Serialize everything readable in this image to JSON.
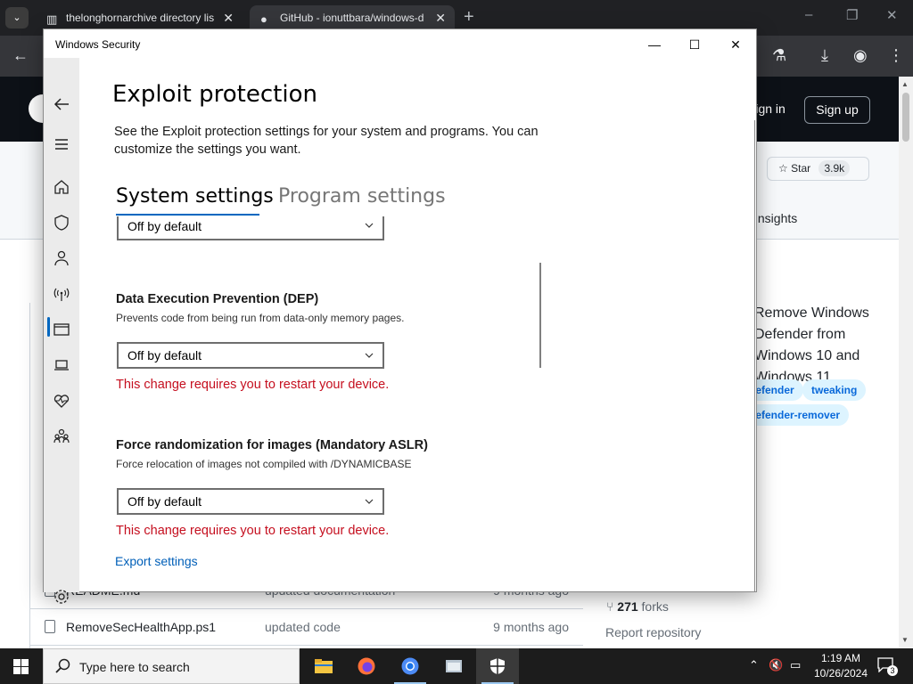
{
  "browser": {
    "tab_menu_icon": "chevron-down-icon",
    "tabs": [
      {
        "title": "thelonghornarchive directory lis",
        "favicon": "archive-icon"
      },
      {
        "title": "GitHub - ionuttbara/windows-d",
        "favicon": "github-icon"
      }
    ],
    "new_tab": "+",
    "window_controls": {
      "minimize": "–",
      "maximize": "❐",
      "close": "✕"
    }
  },
  "github": {
    "sign_in": "Sign in",
    "sign_up": "Sign up",
    "star_label": "Star",
    "star_count": "3.9k",
    "insights_tab": "Insights",
    "description": "Remove Windows Defender from Windows 10 and Windows 11.",
    "topics": [
      "defender",
      "tweaking",
      "defender-remover"
    ],
    "files": [
      {
        "name": "README.md",
        "message": "updated documentation",
        "age": "9 months ago"
      },
      {
        "name": "RemoveSecHealthApp.ps1",
        "message": "updated code",
        "age": "9 months ago"
      }
    ],
    "forks_count": "271",
    "forks_label": "forks",
    "report": "Report repository"
  },
  "windows_security": {
    "window_title": "Windows Security",
    "page_title": "Exploit protection",
    "intro": "See the Exploit protection settings for your system and programs.  You can customize the settings you want.",
    "tabs": {
      "system": "System settings",
      "program": "Program settings"
    },
    "top_dropdown_value": "Off by default",
    "options": [
      {
        "title": "Data Execution Prevention (DEP)",
        "description": "Prevents code from being run from data-only memory pages.",
        "value": "Off by default",
        "warning": "This change requires you to restart your device."
      },
      {
        "title": "Force randomization for images (Mandatory ASLR)",
        "description": "Force relocation of images not compiled with /DYNAMICBASE",
        "value": "Off by default",
        "warning": "This change requires you to restart your device."
      }
    ],
    "export_link": "Export settings",
    "accent_color": "#0067c0",
    "warning_color": "#c50f1f"
  },
  "taskbar": {
    "search_placeholder": "Type here to search",
    "time": "1:19 AM",
    "date": "10/26/2024",
    "notification_count": "3"
  }
}
